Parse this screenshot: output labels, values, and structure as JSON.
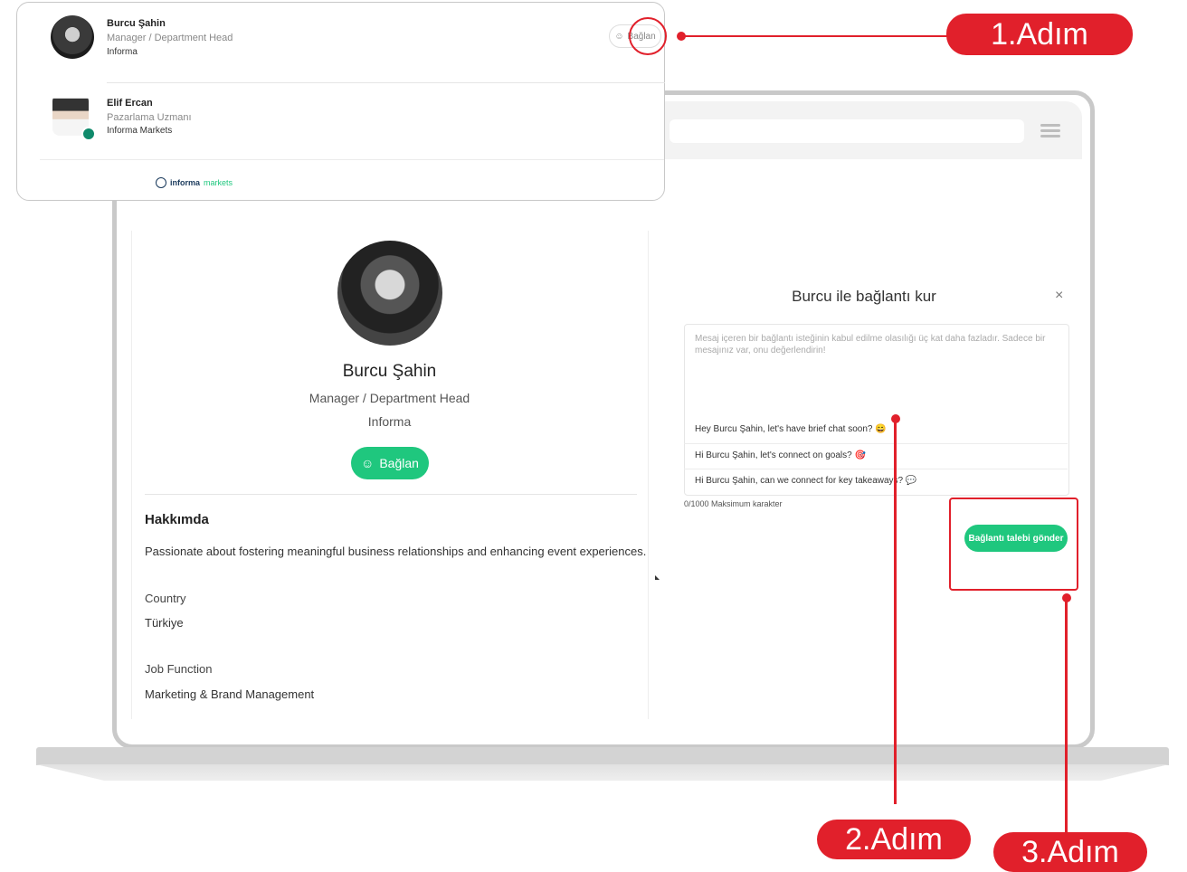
{
  "profile": {
    "name": "Burcu Şahin",
    "title": "Manager / Department Head",
    "company": "Informa",
    "connect_label": "Bağlan",
    "about_heading": "Hakkımda",
    "about_text": "Passionate about fostering meaningful business relationships and enhancing event experiences.",
    "country_label": "Country",
    "country_value": "Türkiye",
    "job_function_label": "Job Function",
    "job_function_value": "Marketing & Brand Management"
  },
  "modal": {
    "title": "Burcu ile bağlantı kur",
    "close": "×",
    "placeholder": "Mesaj içeren bir bağlantı isteğinin kabul edilme olasılığı üç kat daha fazladır. Sadece bir mesajınız var, onu değerlendirin!",
    "suggestions": [
      "Hey Burcu Şahin, let's have brief chat soon? 😄",
      "Hi Burcu Şahin, let's connect on goals? 🎯",
      "Hi Burcu Şahin, can we connect for key takeaways? 💬"
    ],
    "counter": "0/1000 Maksimum karakter",
    "send_label": "Bağlantı talebi gönder"
  },
  "list_card": {
    "people": [
      {
        "name": "Burcu Şahin",
        "title": "Manager / Department Head",
        "org": "Informa"
      },
      {
        "name": "Elif Ercan",
        "title": "Pazarlama Uzmanı",
        "org": "Informa Markets"
      }
    ],
    "connect_label": "Bağlan",
    "logo_text_bold": "informa",
    "logo_text_light": "markets"
  },
  "annotations": {
    "step1": "1.Adım",
    "step2": "2.Adım",
    "step3": "3.Adım",
    "color": "#e1202b"
  },
  "accent_color": "#1fc77e"
}
